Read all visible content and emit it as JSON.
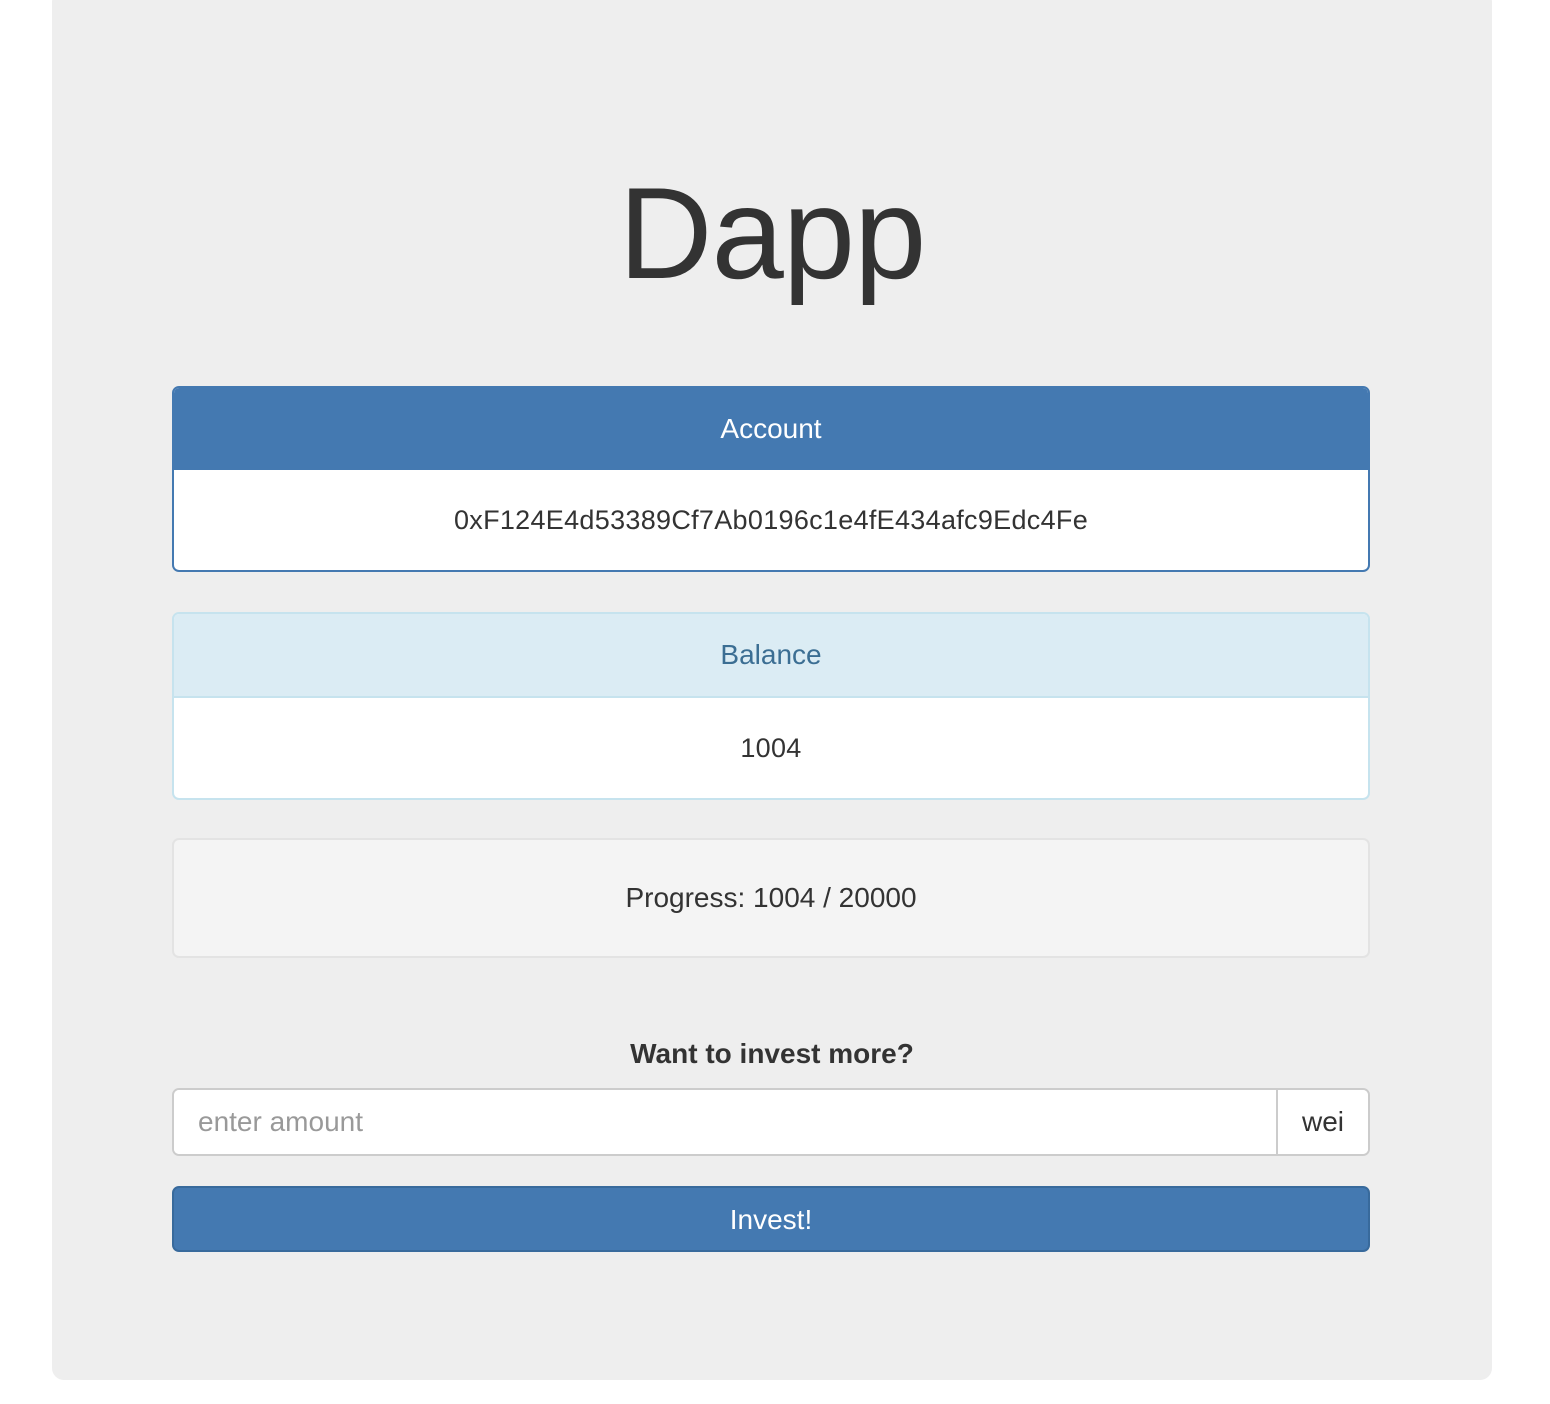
{
  "app": {
    "title": "Dapp"
  },
  "account": {
    "heading": "Account",
    "address": "0xF124E4d53389Cf7Ab0196c1e4fE434afc9Edc4Fe"
  },
  "balance": {
    "heading": "Balance",
    "value": "1004"
  },
  "progress": {
    "text": "Progress: 1004 / 20000",
    "current": 1004,
    "goal": 20000
  },
  "invest": {
    "prompt": "Want to invest more?",
    "amount_value": "",
    "amount_placeholder": "enter amount",
    "unit": "wei",
    "button_label": "Invest!"
  },
  "colors": {
    "primary": "#4479b1",
    "info_bg": "#dbecf4",
    "info_text": "#3b6e93",
    "jumbotron_bg": "#eeeeee"
  }
}
